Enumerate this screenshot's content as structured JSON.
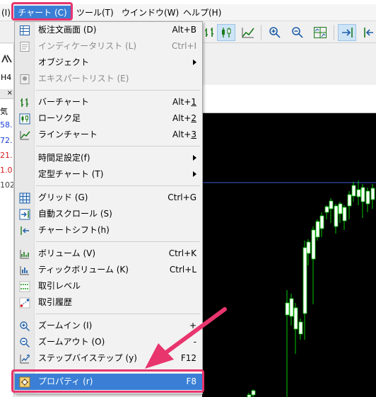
{
  "menubar": {
    "items": [
      {
        "label": "(I)"
      },
      {
        "label": "チャート (C)"
      },
      {
        "label": "ツール(T)"
      },
      {
        "label": "ウインドウ(W)"
      },
      {
        "label": "ヘルプ(H)"
      }
    ]
  },
  "left_panel": {
    "timeframe": "H4",
    "close_glyph": "×",
    "rows": [
      {
        "text": "気",
        "color": "#000000"
      },
      {
        "text": "58.",
        "color": "#1a3fd6"
      },
      {
        "text": "72.",
        "color": "#1a3fd6"
      },
      {
        "text": "21.",
        "color": "#d61a1a"
      },
      {
        "text": "1.0",
        "color": "#d61a1a"
      },
      {
        "text": "102",
        "color": "#444444"
      }
    ]
  },
  "menu": {
    "items": [
      {
        "label": "板注文画面 (D)",
        "shortcut": "Alt+B",
        "icon": "depth-of-market-icon",
        "disabled": false
      },
      {
        "label": "インディケータリスト (L)",
        "shortcut": "Ctrl+I",
        "icon": "indicator-list-icon",
        "disabled": true
      },
      {
        "label": "オブジェクト",
        "shortcut": "",
        "icon": "",
        "disabled": false,
        "submenu": true
      },
      {
        "label": "エキスパートリスト (E)",
        "shortcut": "",
        "icon": "expert-list-icon",
        "disabled": true
      },
      {
        "label": "バーチャート",
        "shortcut": "Alt+1",
        "icon": "bar-chart-icon",
        "disabled": false
      },
      {
        "label": "ローソク足",
        "shortcut": "Alt+2",
        "icon": "candlestick-icon",
        "disabled": false
      },
      {
        "label": "ラインチャート",
        "shortcut": "Alt+3",
        "icon": "line-chart-icon",
        "disabled": false
      },
      {
        "label": "時間足設定(f)",
        "shortcut": "",
        "icon": "",
        "disabled": false,
        "submenu": true
      },
      {
        "label": "定型チャート (T)",
        "shortcut": "",
        "icon": "",
        "disabled": false,
        "submenu": true
      },
      {
        "label": "グリッド (G)",
        "shortcut": "Ctrl+G",
        "icon": "grid-icon",
        "disabled": false
      },
      {
        "label": "自動スクロール (S)",
        "shortcut": "",
        "icon": "auto-scroll-icon",
        "disabled": false
      },
      {
        "label": "チャートシフト(h)",
        "shortcut": "",
        "icon": "chart-shift-icon",
        "disabled": false
      },
      {
        "label": "ボリューム (V)",
        "shortcut": "Ctrl+K",
        "icon": "volume-icon",
        "disabled": false
      },
      {
        "label": "ティックボリューム (K)",
        "shortcut": "Ctrl+L",
        "icon": "tick-volume-icon",
        "disabled": false
      },
      {
        "label": "取引レベル",
        "shortcut": "",
        "icon": "trade-levels-icon",
        "disabled": false
      },
      {
        "label": "取引履歴",
        "shortcut": "",
        "icon": "trade-history-icon",
        "disabled": false
      },
      {
        "label": "ズームイン (I)",
        "shortcut": "+",
        "icon": "zoom-in-icon",
        "disabled": false
      },
      {
        "label": "ズームアウト (O)",
        "shortcut": "-",
        "icon": "zoom-out-icon",
        "disabled": false
      },
      {
        "label": "ステップバイステップ (y)",
        "shortcut": "F12",
        "icon": "step-by-step-icon",
        "disabled": false
      },
      {
        "label": "プロパティ (r)",
        "shortcut": "F8",
        "icon": "properties-icon",
        "disabled": false,
        "selected": true
      }
    ]
  },
  "colors": {
    "menu_highlight": "#3a7fd5",
    "annotation": "#e8356e",
    "chart_background": "#000000",
    "candle_up": "#ffffff",
    "candle_wick": "#00c800"
  }
}
